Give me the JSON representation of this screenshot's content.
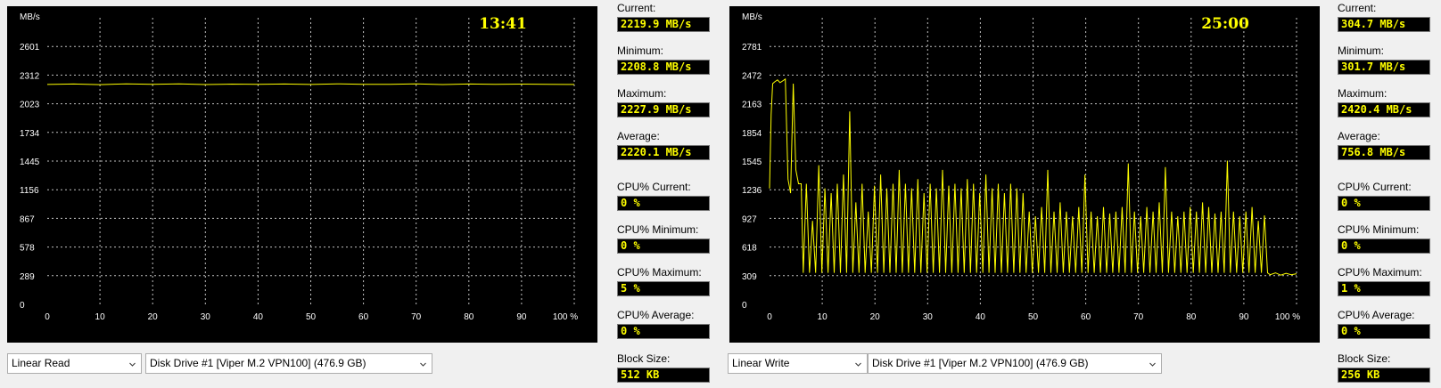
{
  "chart_data": [
    {
      "type": "line",
      "ylabel": "MB/s",
      "y_ticks": [
        "0",
        "289",
        "578",
        "867",
        "1156",
        "1445",
        "1734",
        "2023",
        "2312",
        "2601"
      ],
      "x_ticks": [
        "0",
        "10",
        "20",
        "30",
        "40",
        "50",
        "60",
        "70",
        "80",
        "90",
        "100 %"
      ],
      "xlim": [
        0,
        100
      ],
      "ylim": [
        0,
        2890
      ],
      "grid": true,
      "timer": "13:41",
      "series": [
        {
          "color": "#ffff00",
          "x": [
            0,
            5,
            10,
            15,
            20,
            25,
            30,
            35,
            40,
            45,
            50,
            55,
            60,
            65,
            70,
            75,
            80,
            85,
            90,
            95,
            100
          ],
          "y": [
            2218,
            2222,
            2216,
            2224,
            2219,
            2223,
            2217,
            2221,
            2219,
            2222,
            2218,
            2224,
            2220,
            2219,
            2223,
            2217,
            2222,
            2220,
            2221,
            2219,
            2218
          ]
        }
      ]
    },
    {
      "type": "line",
      "ylabel": "MB/s",
      "y_ticks": [
        "0",
        "309",
        "618",
        "927",
        "1236",
        "1545",
        "1854",
        "2163",
        "2472",
        "2781"
      ],
      "x_ticks": [
        "0",
        "10",
        "20",
        "30",
        "40",
        "50",
        "60",
        "70",
        "80",
        "90",
        "100 %"
      ],
      "xlim": [
        0,
        100
      ],
      "ylim": [
        0,
        3090
      ],
      "grid": true,
      "timer": "25:00",
      "series": [
        {
          "color": "#ffff00",
          "x": [
            0,
            0.3,
            0.6,
            1,
            1.5,
            2,
            2.5,
            3,
            3.5,
            4,
            4.5,
            5,
            5.5,
            6
          ],
          "y": [
            1250,
            2050,
            2380,
            2400,
            2420,
            2390,
            2410,
            2430,
            1350,
            1200,
            2380,
            1450,
            1300,
            1300
          ],
          "spikes": {
            "start": 6.4,
            "end": 94.5,
            "low": 340,
            "peaks": [
              1300,
              900,
              1500,
              1250,
              1200,
              1300,
              1400,
              2080,
              1100,
              1300,
              1000,
              1280,
              1400,
              1250,
              1300,
              1450,
              1300,
              1250,
              1350,
              1200,
              1300,
              1250,
              1450,
              1280,
              1300,
              1250,
              1350,
              1300,
              1200,
              1400,
              1250,
              1300,
              1200,
              1300,
              1250,
              1200,
              1000,
              950,
              1050,
              1450,
              1000,
              1100,
              1000,
              950,
              1050,
              1400,
              1000,
              950,
              1050,
              980,
              1000,
              1050,
              1520,
              1000,
              950,
              1050,
              1000,
              1100,
              1480,
              1000,
              950,
              1000,
              1050,
              1000,
              1100,
              1050,
              980,
              1000,
              1550,
              1000,
              950,
              1000,
              1050,
              900,
              960
            ]
          },
          "tail_x": [
            95,
            96,
            97,
            98,
            99,
            100
          ],
          "tail_y": [
            320,
            340,
            315,
            335,
            320,
            330
          ]
        }
      ]
    }
  ],
  "panels": [
    {
      "stats": [
        {
          "label": "Current:",
          "value": "2219.9 MB/s"
        },
        {
          "label": "Minimum:",
          "value": "2208.8 MB/s"
        },
        {
          "label": "Maximum:",
          "value": "2227.9 MB/s"
        },
        {
          "label": "Average:",
          "value": "2220.1 MB/s"
        },
        {
          "label": "CPU% Current:",
          "value": "0 %"
        },
        {
          "label": "CPU% Minimum:",
          "value": "0 %"
        },
        {
          "label": "CPU% Maximum:",
          "value": "5 %"
        },
        {
          "label": "CPU% Average:",
          "value": "0 %"
        },
        {
          "label": "Block Size:",
          "value": "512 KB"
        }
      ],
      "test_mode": "Linear Read",
      "drive": "Disk Drive #1  [Viper M.2 VPN100]  (476.9 GB)"
    },
    {
      "stats": [
        {
          "label": "Current:",
          "value": "304.7 MB/s"
        },
        {
          "label": "Minimum:",
          "value": "301.7 MB/s"
        },
        {
          "label": "Maximum:",
          "value": "2420.4 MB/s"
        },
        {
          "label": "Average:",
          "value": "756.8 MB/s"
        },
        {
          "label": "CPU% Current:",
          "value": "0 %"
        },
        {
          "label": "CPU% Minimum:",
          "value": "0 %"
        },
        {
          "label": "CPU% Maximum:",
          "value": "1 %"
        },
        {
          "label": "CPU% Average:",
          "value": "0 %"
        },
        {
          "label": "Block Size:",
          "value": "256 KB"
        }
      ],
      "test_mode": "Linear Write",
      "drive": "Disk Drive #1  [Viper M.2 VPN100]  (476.9 GB)"
    }
  ],
  "icons": {
    "dropdown": "chevron-down-icon"
  },
  "colors": {
    "plot_bg": "#000000",
    "trace": "#ffff00",
    "grid": "#c0c0c0",
    "text": "#ffffff",
    "window_bg": "#f0f0f0"
  }
}
